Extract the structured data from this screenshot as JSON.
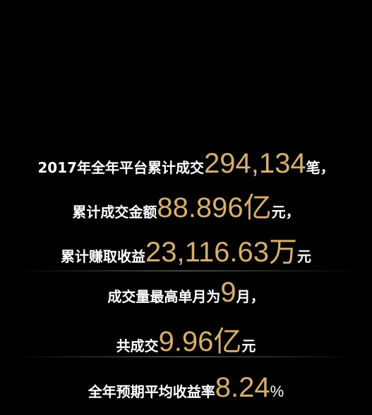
{
  "colors": {
    "background": "#000000",
    "text": "#ffffff",
    "highlight": "#d6ae6c"
  },
  "stats": {
    "line1": {
      "prefix": "2017年全年平台累计成交",
      "value": "294,134",
      "suffix": "笔，"
    },
    "line2": {
      "prefix": "累计成交金额",
      "value": "88.896",
      "unit": "亿",
      "suffix": "元，"
    },
    "line3": {
      "prefix": "累计赚取收益",
      "value": "23,116.63",
      "unit": "万",
      "suffix": "元"
    },
    "line4": {
      "prefix": "成交量最高单月为",
      "value": "9",
      "suffix": "月，"
    },
    "line5": {
      "prefix": "共成交",
      "value": "9.96",
      "unit": "亿",
      "suffix": "元"
    },
    "line6": {
      "prefix": "全年预期平均收益率",
      "value": "8.24",
      "suffix": "%"
    }
  }
}
